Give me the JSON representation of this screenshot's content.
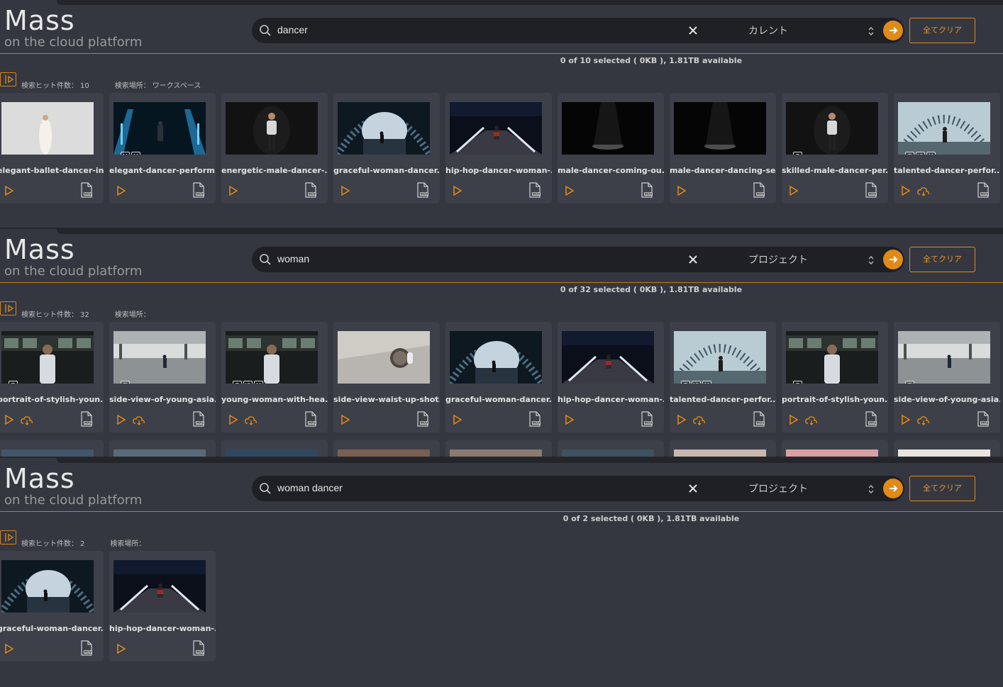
{
  "app": {
    "logo_title": "Mass",
    "logo_subtitle": "on the cloud platform",
    "clear_all_label": "全てクリア",
    "hit_label": "検索ヒット件数：",
    "location_label": "検索場所："
  },
  "panels": [
    {
      "query": "dancer",
      "scope": "カレント",
      "status": "0 of 10 selected ( 0KB ), 1.81TB available",
      "hit_count": "10",
      "location": "ワークスペース",
      "cards": [
        {
          "name": "elegant-ballet-dancer-in...",
          "thumb": "bright",
          "badges": [],
          "cloud": false,
          "file": "MOV"
        },
        {
          "name": "elegant-dancer-perform...",
          "thumb": "blue",
          "badges": [
            "M",
            "M"
          ],
          "cloud": false,
          "file": "MOV"
        },
        {
          "name": "energetic-male-dancer-...",
          "thumb": "dark",
          "badges": [],
          "cloud": false,
          "file": "MOV"
        },
        {
          "name": "graceful-woman-dancer...",
          "thumb": "tunnel",
          "badges": [],
          "cloud": false,
          "file": "MOV"
        },
        {
          "name": "hip-hop-dancer-woman-...",
          "thumb": "night",
          "badges": [],
          "cloud": false,
          "file": "MOV"
        },
        {
          "name": "male-dancer-coming-ou...",
          "thumb": "black",
          "badges": [],
          "cloud": false,
          "file": "MOV"
        },
        {
          "name": "male-dancer-dancing-se...",
          "thumb": "black",
          "badges": [],
          "cloud": false,
          "file": "MOV"
        },
        {
          "name": "skilled-male-dancer-per...",
          "thumb": "dark",
          "badges": [
            "T"
          ],
          "cloud": false,
          "file": "MOV"
        },
        {
          "name": "talented-dancer-perfor...",
          "thumb": "bridge",
          "badges": [
            "T",
            "IO",
            "M"
          ],
          "cloud": true,
          "file": "MOV"
        }
      ]
    },
    {
      "query": "woman",
      "scope": "プロジェクト",
      "status": "0 of 32 selected ( 0KB ), 1.81TB available",
      "hit_count": "32",
      "location": "",
      "cards": [
        {
          "name": "portrait-of-stylish-youn...",
          "thumb": "subway",
          "badges": [
            "T"
          ],
          "cloud": true,
          "file": "MP4"
        },
        {
          "name": "side-view-of-young-asia...",
          "thumb": "station",
          "badges": [
            "T"
          ],
          "cloud": true,
          "file": "MP4"
        },
        {
          "name": "young-woman-with-hea...",
          "thumb": "subway",
          "badges": [
            "T",
            "IO",
            "M"
          ],
          "cloud": true,
          "file": "MP4"
        },
        {
          "name": "side-view-waist-up-shot...",
          "thumb": "grey",
          "badges": [],
          "cloud": false,
          "file": "MOV"
        },
        {
          "name": "graceful-woman-dancer...",
          "thumb": "tunnel",
          "badges": [],
          "cloud": false,
          "file": "MOV"
        },
        {
          "name": "hip-hop-dancer-woman-...",
          "thumb": "night",
          "badges": [],
          "cloud": false,
          "file": "MOV"
        },
        {
          "name": "talented-dancer-perfor...",
          "thumb": "bridge",
          "badges": [
            "T",
            "IO",
            "M"
          ],
          "cloud": true,
          "file": "MOV"
        },
        {
          "name": "portrait-of-stylish-youn...",
          "thumb": "subway",
          "badges": [
            "T"
          ],
          "cloud": true,
          "file": "MP4"
        },
        {
          "name": "side-view-of-young-asia...",
          "thumb": "station",
          "badges": [
            "T"
          ],
          "cloud": true,
          "file": "MP4"
        }
      ]
    },
    {
      "query": "woman dancer",
      "scope": "プロジェクト",
      "status": "0 of 2 selected ( 0KB ), 1.81TB available",
      "hit_count": "2",
      "location": "",
      "cards": [
        {
          "name": "graceful-woman-dancer...",
          "thumb": "tunnel",
          "badges": [],
          "cloud": false,
          "file": "MOV"
        },
        {
          "name": "hip-hop-dancer-woman-...",
          "thumb": "night",
          "badges": [],
          "cloud": false,
          "file": "MOV"
        }
      ]
    }
  ],
  "colors": {
    "accent": "#e08a18",
    "panel_bg": "#343740",
    "card_bg": "#3d4049",
    "search_bg": "#1e2025"
  }
}
